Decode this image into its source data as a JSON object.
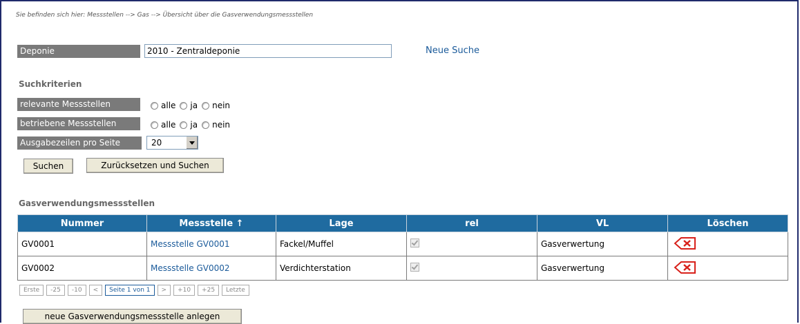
{
  "breadcrumb": "Sie befinden sich hier: Messstellen --> Gas --> Übersicht über die Gasverwendungsmessstellen",
  "deponie": {
    "label": "Deponie",
    "value": "2010 - Zentraldeponie",
    "neue_suche": "Neue Suche"
  },
  "search": {
    "title": "Suchkriterien",
    "relevante_label": "relevante Messstellen",
    "betriebene_label": "betriebene Messstellen",
    "ausgabe_label": "Ausgabezeilen pro Seite",
    "options": [
      "alle",
      "ja",
      "nein"
    ],
    "ausgabe_value": "20",
    "suchen_button": "Suchen",
    "zuruecksetzen_button": "Zurücksetzen und Suchen"
  },
  "table": {
    "title": "Gasverwendungsmessstellen",
    "headers": [
      "Nummer",
      "Messstelle ↑",
      "Lage",
      "rel",
      "VL",
      "Löschen"
    ],
    "rows": [
      {
        "nummer": "GV0001",
        "messstelle": "Messstelle GV0001",
        "lage": "Fackel/Muffel",
        "vl": "Gasverwertung"
      },
      {
        "nummer": "GV0002",
        "messstelle": "Messstelle GV0002",
        "lage": "Verdichterstation",
        "vl": "Gasverwertung"
      }
    ]
  },
  "pager": {
    "erste": "Erste",
    "m25": "-25",
    "m10": "-10",
    "prev": "<",
    "current": "Seite 1 von 1",
    "next": ">",
    "p10": "+10",
    "p25": "+25",
    "letzte": "Letzte"
  },
  "new_button": "neue Gasverwendungsmessstelle anlegen",
  "icons": {
    "delete": "delete-icon",
    "dropdown": "chevron-down-icon"
  },
  "colors": {
    "header": "#1f6ba0",
    "label_bg": "#7a7a7a",
    "link": "#1a5a9a",
    "delete": "#d8201a"
  }
}
